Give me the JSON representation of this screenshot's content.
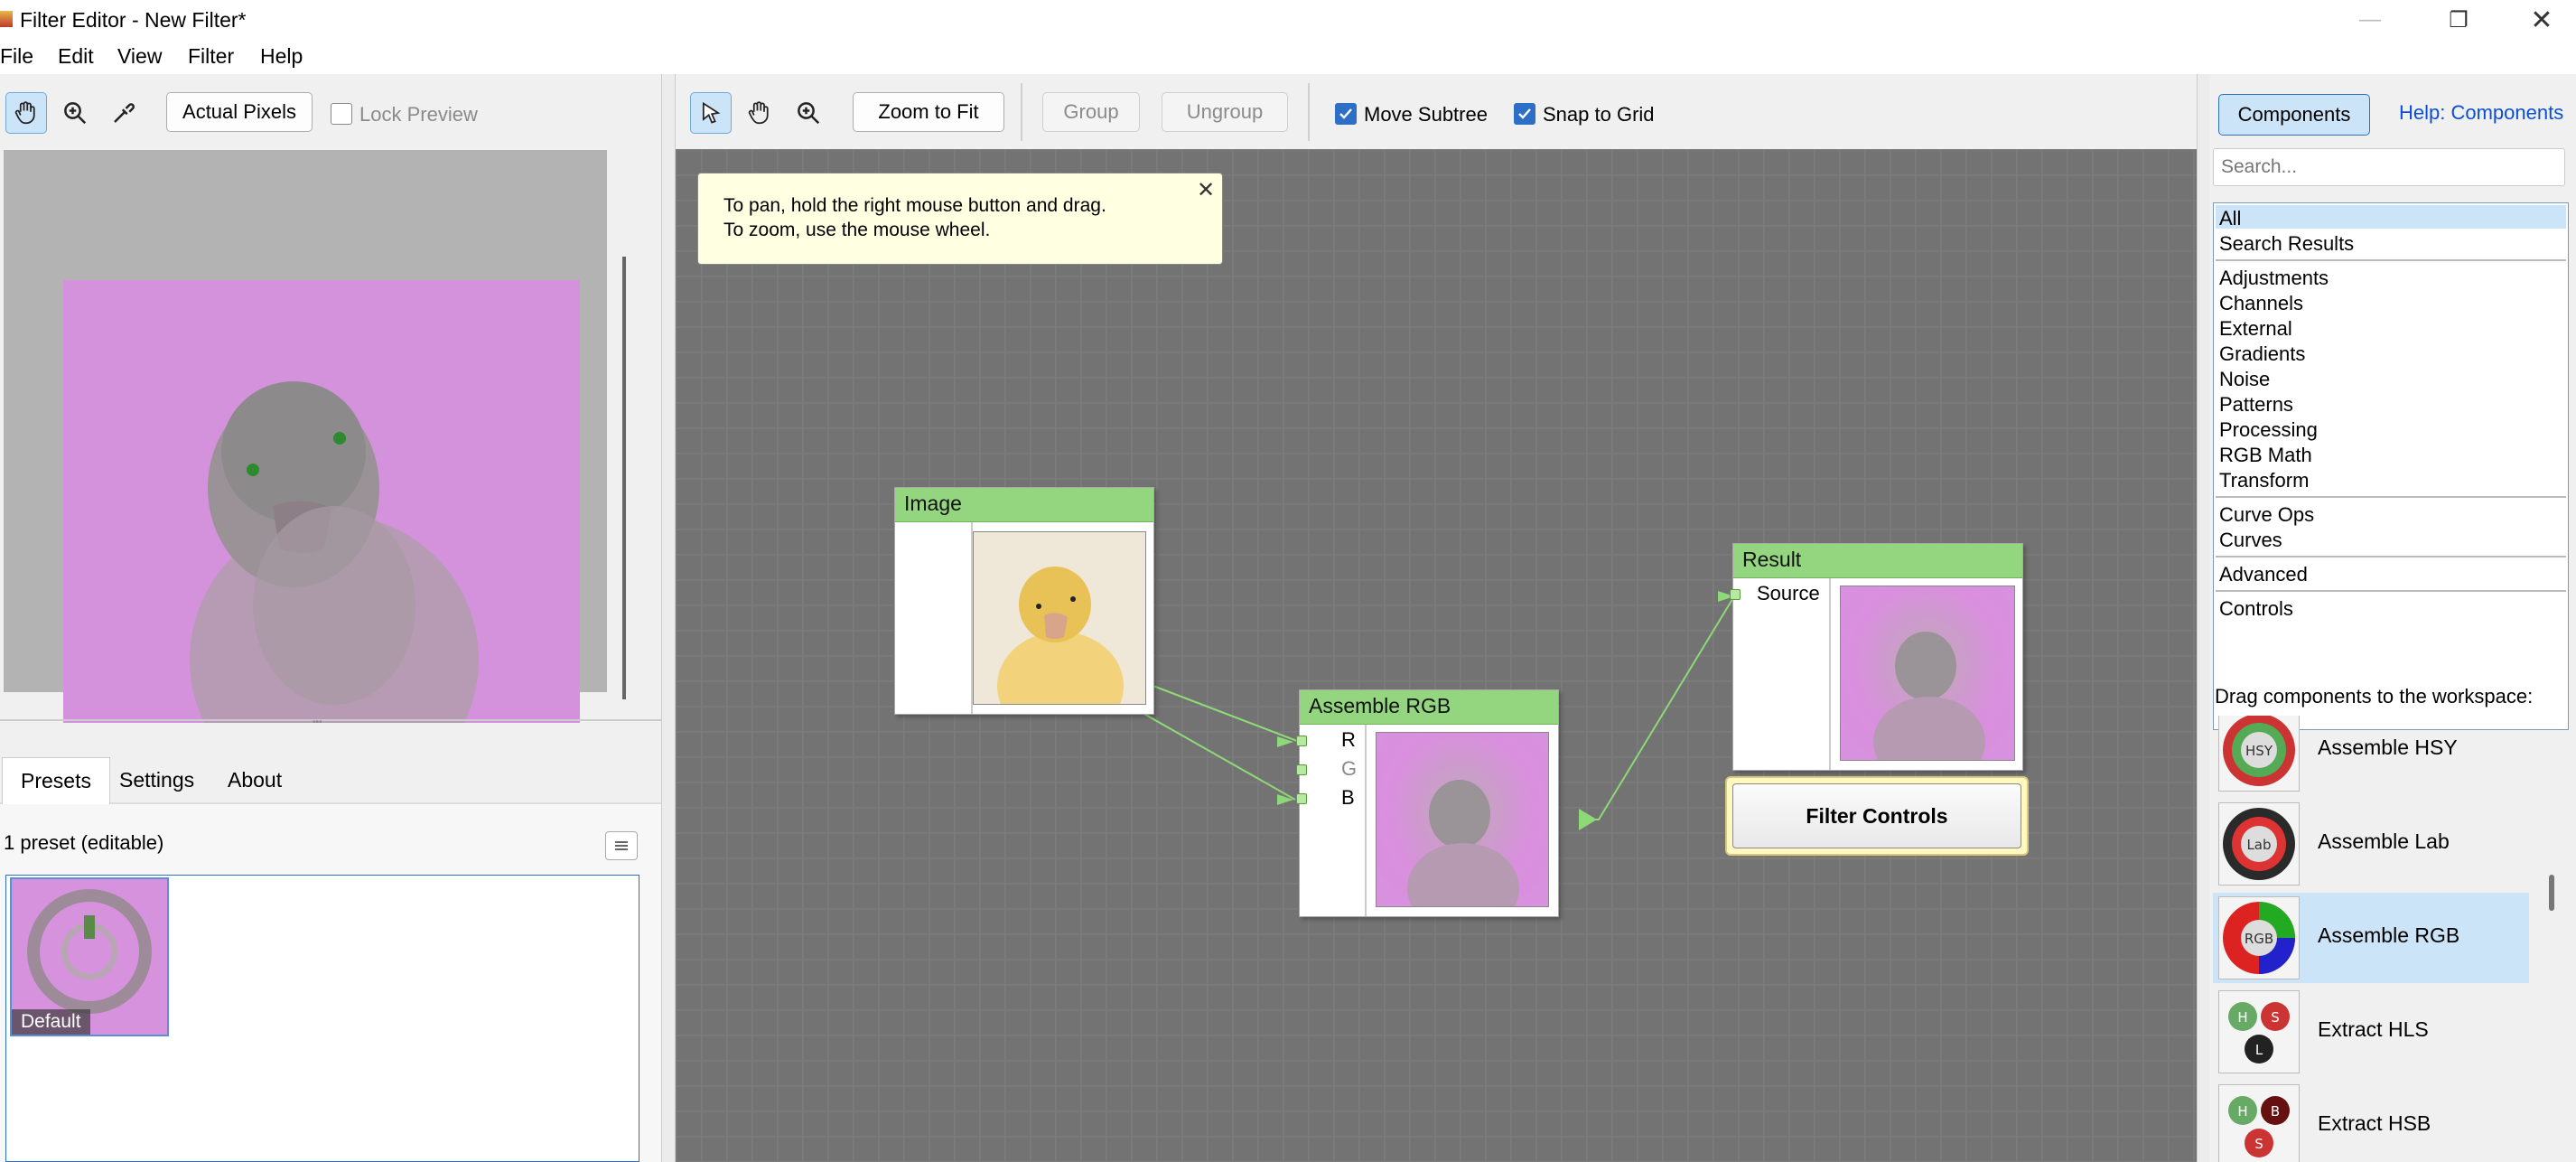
{
  "window": {
    "title": "Filter Editor - New Filter*"
  },
  "menu": {
    "items": [
      "File",
      "Edit",
      "View",
      "Filter",
      "Help"
    ]
  },
  "left_toolbar": {
    "actual_pixels": "Actual Pixels",
    "lock_preview": "Lock Preview"
  },
  "tabs": {
    "presets": "Presets",
    "settings": "Settings",
    "about": "About"
  },
  "presets": {
    "count_label": "1 preset (editable)",
    "items": [
      {
        "label": "Default"
      }
    ]
  },
  "center_toolbar": {
    "zoom_to_fit": "Zoom to Fit",
    "group": "Group",
    "ungroup": "Ungroup",
    "move_subtree": "Move Subtree",
    "snap_to_grid": "Snap to Grid",
    "move_subtree_checked": true,
    "snap_to_grid_checked": true
  },
  "hint": {
    "line1": "To pan, hold the right mouse button and drag.",
    "line2": "To zoom, use the mouse wheel."
  },
  "nodes": {
    "image": {
      "title": "Image"
    },
    "assemble": {
      "title": "Assemble RGB",
      "ports": [
        "R",
        "G",
        "B"
      ]
    },
    "result": {
      "title": "Result",
      "port": "Source"
    },
    "filter_controls": "Filter Controls"
  },
  "right_panel": {
    "components_button": "Components",
    "help_link": "Help: Components",
    "search_placeholder": "Search...",
    "categories": [
      "All",
      "Search Results",
      "Adjustments",
      "Channels",
      "External",
      "Gradients",
      "Noise",
      "Patterns",
      "Processing",
      "RGB Math",
      "Transform",
      "Curve Ops",
      "Curves",
      "Advanced",
      "Controls"
    ],
    "drag_label": "Drag components to the workspace:",
    "components": [
      {
        "name": "Assemble HSY",
        "icon": "HSY"
      },
      {
        "name": "Assemble Lab",
        "icon": "Lab"
      },
      {
        "name": "Assemble RGB",
        "icon": "RGB"
      },
      {
        "name": "Extract HLS",
        "icon": "H S L"
      },
      {
        "name": "Extract HSB",
        "icon": "H B S"
      }
    ]
  },
  "colors": {
    "node_header": "#93d67f",
    "canvas": "#737373",
    "selection": "#cce4f7",
    "link": "#0b4fd6"
  }
}
